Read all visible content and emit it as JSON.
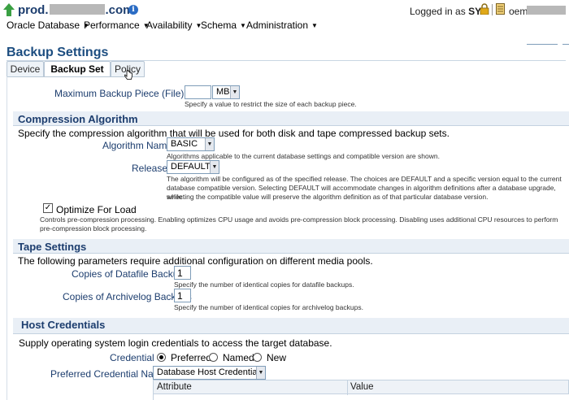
{
  "header": {
    "host_prefix": "prod.",
    "host_suffix": ".com",
    "logged_in_text": "Logged in as",
    "user": "SYS",
    "target_user": "oem"
  },
  "menu": [
    {
      "label": "Oracle Database"
    },
    {
      "label": "Performance"
    },
    {
      "label": "Availability"
    },
    {
      "label": "Schema"
    },
    {
      "label": "Administration"
    }
  ],
  "page": {
    "title": "Backup Settings"
  },
  "tabs": [
    {
      "label": "Device",
      "active": false
    },
    {
      "label": "Backup Set",
      "active": true
    },
    {
      "label": "Policy",
      "active": false
    }
  ],
  "backup_piece": {
    "label": "Maximum Backup Piece (File) Size",
    "value": "",
    "unit": "MB",
    "help": "Specify a value to restrict the size of each backup piece."
  },
  "compression": {
    "heading": "Compression Algorithm",
    "intro": "Specify the compression algorithm that will be used for both disk and tape compressed backup sets.",
    "algorithm_label": "Algorithm Name",
    "algorithm_value": "BASIC",
    "algorithm_help": "Algorithms applicable to the current database settings and compatible version are shown.",
    "release_label": "Release",
    "release_value": "DEFAULT",
    "release_help_1": "The algorithm will be configured as of the specified release. The choices are DEFAULT and a specific version equal to the current",
    "release_help_2": "database compatible version. Selecting DEFAULT will accommodate changes in algorithm definitions after a database upgrade, while",
    "release_help_3": "selecting the compatible value will preserve the algorithm definition as of that particular database version.",
    "optimize_label": "Optimize For Load",
    "optimize_checked": true,
    "optimize_help_1": "Controls pre-compression processing. Enabling optimizes CPU usage and avoids pre-compression block processing. Disabling uses additional CPU resources to perform",
    "optimize_help_2": "pre-compression block processing."
  },
  "tape": {
    "heading": "Tape Settings",
    "intro": "The following parameters require additional configuration on different media pools.",
    "datafile_label": "Copies of Datafile Backups",
    "datafile_value": "1",
    "datafile_help": "Specify the number of identical copies for datafile backups.",
    "archivelog_label": "Copies of Archivelog Backups",
    "archivelog_value": "1",
    "archivelog_help": "Specify the number of identical copies for archivelog backups."
  },
  "host_credentials": {
    "heading": "Host Credentials",
    "intro": "Supply operating system login credentials to access the target database.",
    "credential_label": "Credential",
    "options": [
      {
        "label": "Preferred",
        "selected": true
      },
      {
        "label": "Named",
        "selected": false
      },
      {
        "label": "New",
        "selected": false
      }
    ],
    "preferred_name_label": "Preferred Credential Name",
    "preferred_name_value": "Database Host Credentials",
    "table_headers": [
      "Attribute",
      "Value"
    ]
  },
  "colors": {
    "heading_blue": "#1c4d80",
    "label_blue": "#1c3d6e",
    "section_bg": "#e9eff6",
    "up_arrow_green": "#3aa043",
    "lock_gold": "#e0a818"
  }
}
